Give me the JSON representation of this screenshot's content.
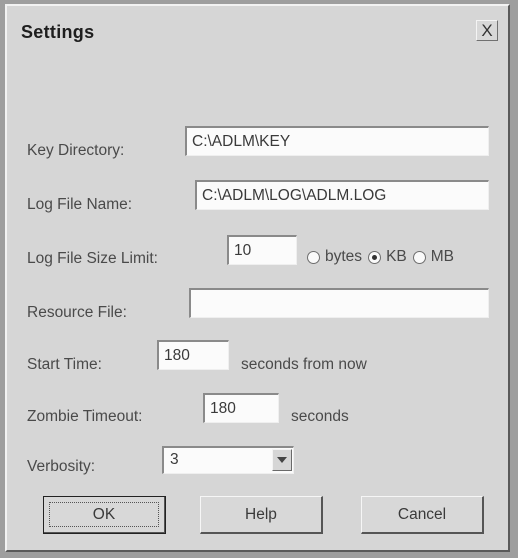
{
  "window": {
    "title": "Settings",
    "close_glyph": "X"
  },
  "fields": {
    "key_directory": {
      "label": "Key Directory:",
      "value": "C:\\ADLM\\KEY"
    },
    "log_file_name": {
      "label": "Log File Name:",
      "value": "C:\\ADLM\\LOG\\ADLM.LOG"
    },
    "log_file_size_limit": {
      "label": "Log File Size Limit:",
      "value": "10",
      "units": [
        {
          "label": "bytes",
          "selected": false
        },
        {
          "label": "KB",
          "selected": true
        },
        {
          "label": "MB",
          "selected": false
        }
      ]
    },
    "resource_file": {
      "label": "Resource File:",
      "value": ""
    },
    "start_time": {
      "label": "Start Time:",
      "value": "180",
      "suffix": "seconds from now"
    },
    "zombie_timeout": {
      "label": "Zombie Timeout:",
      "value": "180",
      "suffix": "seconds"
    },
    "verbosity": {
      "label": "Verbosity:",
      "selected": "3"
    }
  },
  "buttons": {
    "ok": "OK",
    "help": "Help",
    "cancel": "Cancel"
  }
}
